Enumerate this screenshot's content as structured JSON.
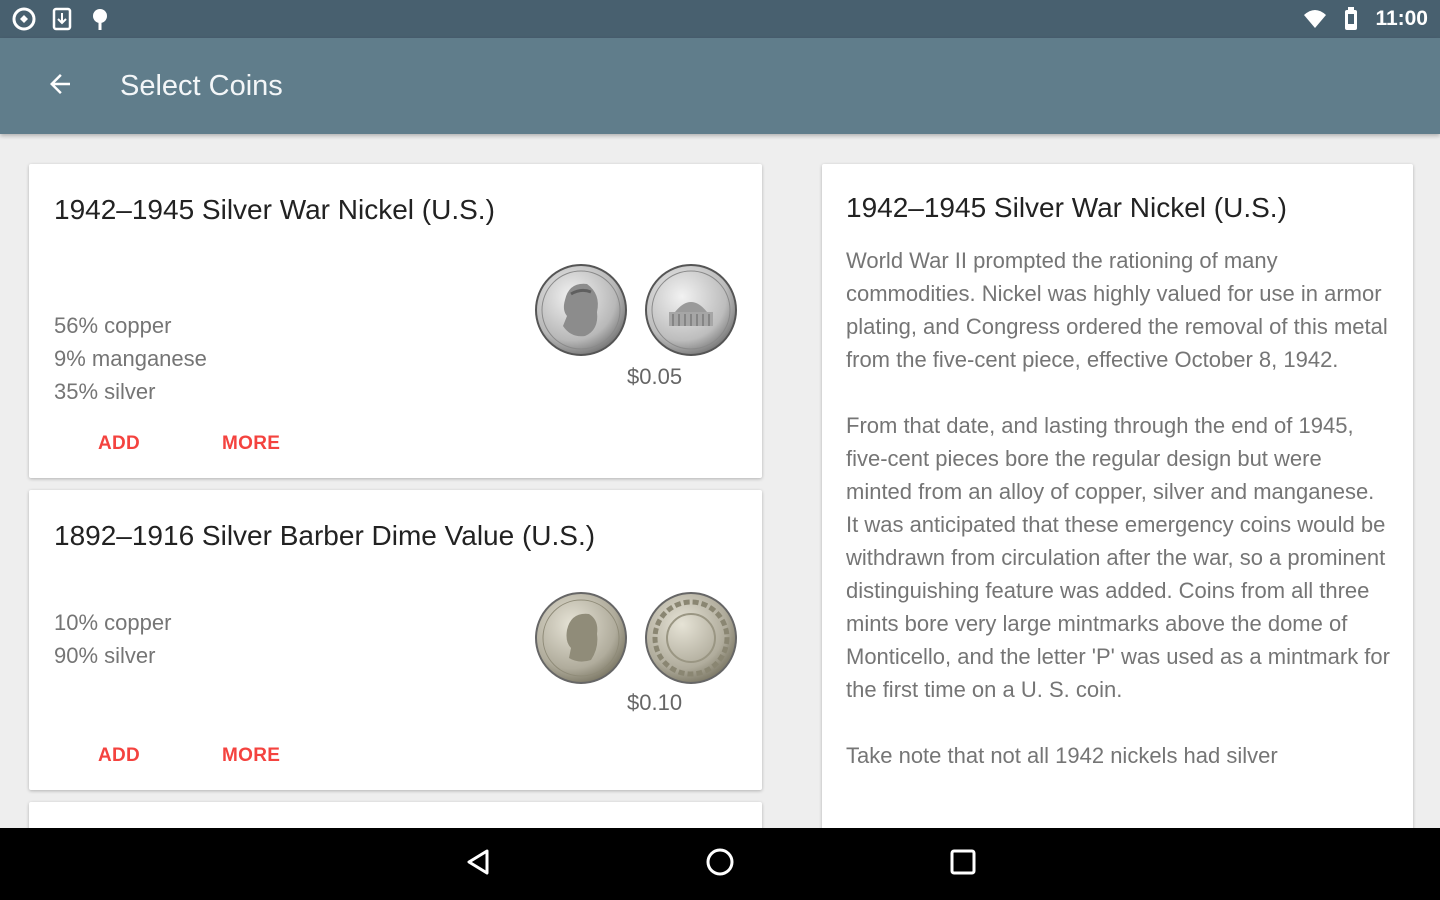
{
  "status_bar": {
    "time": "11:00",
    "left_icons": [
      "sync-icon",
      "download-icon",
      "tree-icon"
    ],
    "right_icons": [
      "wifi-icon",
      "battery-icon"
    ]
  },
  "app_bar": {
    "back_icon": "arrow-back-icon",
    "title": "Select Coins"
  },
  "coins": [
    {
      "title": "1942–1945 Silver War Nickel (U.S.)",
      "composition": [
        "56% copper",
        "9% manganese",
        "35% silver"
      ],
      "price": "$0.05",
      "obverse": "jefferson-nickel-obverse",
      "reverse": "monticello-nickel-reverse",
      "add_label": "ADD",
      "more_label": "MORE"
    },
    {
      "title": "1892–1916 Silver Barber Dime Value (U.S.)",
      "composition": [
        "10% copper",
        "90% silver"
      ],
      "price": "$0.10",
      "obverse": "barber-dime-obverse",
      "reverse": "barber-dime-reverse",
      "add_label": "ADD",
      "more_label": "MORE"
    }
  ],
  "detail": {
    "title": "1942–1945 Silver War Nickel (U.S.)",
    "paragraphs": [
      "World War II prompted the rationing of many commodities. Nickel was highly valued for use in armor plating, and Congress ordered the removal of this metal from the five-cent piece, effective October 8, 1942.",
      "From that date, and lasting through the end of 1945, five-cent pieces bore the regular design but were minted from an alloy of copper, silver and manganese. It was anticipated that these emergency coins would be withdrawn from circulation after the war, so a prominent distinguishing feature was added. Coins from all three mints bore very large mintmarks above the dome of Monticello, and the letter 'P' was used as a mintmark for the first time on a U. S. coin.",
      "Take note that not all 1942 nickels had silver"
    ]
  },
  "nav_bar": {
    "back_icon": "nav-back-icon",
    "home_icon": "nav-home-icon",
    "recents_icon": "nav-recents-icon"
  }
}
